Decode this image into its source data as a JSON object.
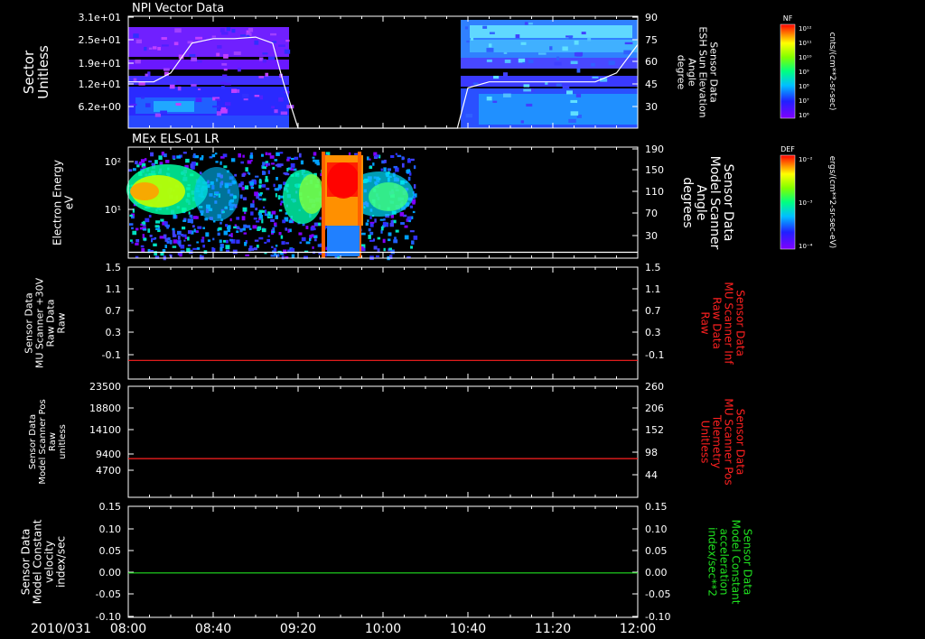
{
  "chart_data": [
    {
      "type": "heatmap",
      "title": "NPI Vector Data",
      "ylabel_left": [
        "Sector",
        "Unitless"
      ],
      "ylabel_right": [
        "Sensor Data",
        "ESH Sun Elevation",
        "Angle",
        "degree"
      ],
      "yticks_left": [
        "3.1e+01",
        "2.5e+01",
        "1.9e+01",
        "1.2e+01",
        "6.2e+00"
      ],
      "yticks_right": [
        "90",
        "75",
        "60",
        "45",
        "30"
      ],
      "ylim_right": [
        15,
        90
      ],
      "color": "#ffffff",
      "line": {
        "x": [
          "08:00",
          "08:12",
          "08:20",
          "08:30",
          "08:40",
          "08:50",
          "09:00",
          "09:08",
          "09:13",
          "09:20",
          "10:20",
          "10:35",
          "10:40",
          "10:50",
          "11:20",
          "11:40",
          "11:50",
          "12:00"
        ],
        "y": [
          46,
          46,
          52,
          72,
          75,
          75,
          76,
          72,
          46,
          15,
          15,
          15,
          42,
          46,
          46,
          46,
          52,
          71
        ]
      },
      "colorbar": {
        "label": "NF",
        "unit": "cnts/(cm**2-sr-sec)",
        "ticks": [
          "10¹²",
          "10¹¹",
          "10¹⁰",
          "10⁹",
          "10⁸",
          "10⁷",
          "10⁶"
        ]
      }
    },
    {
      "type": "heatmap",
      "title": "MEx ELS-01 LR",
      "ylabel_left": [
        "Electron Energy",
        "eV"
      ],
      "ylabel_right": [
        "Sensor Data",
        "Model Scanner",
        "Angle",
        "degrees"
      ],
      "yticks_left": [
        "10²",
        "10¹"
      ],
      "yticks_right": [
        "190",
        "150",
        "110",
        "70",
        "30"
      ],
      "ylim_right": [
        0,
        190
      ],
      "color": "#ffffff",
      "line": {
        "x": [
          "08:00",
          "12:00"
        ],
        "y": [
          10,
          10
        ]
      },
      "colorbar": {
        "label": "DEF",
        "unit": "ergs/(cm**2-sr-sec-eV)",
        "ticks": [
          "10⁻²",
          "10⁻³",
          "10⁻⁴"
        ]
      }
    },
    {
      "type": "line",
      "ylabel_left": [
        "Sensor Data",
        "MU Scanner +30V",
        "Raw Data",
        "Raw"
      ],
      "ylabel_right": [
        "Sensor Data",
        "MU Scanner Inf",
        "Raw Data",
        "Raw"
      ],
      "yticks_left": [
        "1.5",
        "1.1",
        "0.7",
        "0.3",
        "-0.1"
      ],
      "yticks_right": [
        "1.5",
        "1.1",
        "0.7",
        "0.3",
        "-0.1"
      ],
      "ylim": [
        -0.3,
        1.5
      ],
      "color": "#ff2020",
      "line": {
        "x": [
          "08:00",
          "12:00"
        ],
        "y": [
          0.0,
          0.0
        ]
      }
    },
    {
      "type": "line",
      "ylabel_left": [
        "Sensor Data",
        "Model Scanner Pos",
        "Raw",
        "unitless"
      ],
      "ylabel_right": [
        "Sensor Data",
        "MU Scanner Pos",
        "Telemetry",
        "Unitless"
      ],
      "yticks_left": [
        "23500",
        "18800",
        "14100",
        "9400",
        "4700"
      ],
      "yticks_right": [
        "260",
        "206",
        "152",
        "98",
        "44"
      ],
      "ylim": [
        0,
        23500
      ],
      "color": "#ff2020",
      "line": {
        "x": [
          "08:00",
          "12:00"
        ],
        "y": [
          8200,
          8200
        ]
      }
    },
    {
      "type": "line",
      "ylabel_left": [
        "Sensor Data",
        "Model Constant",
        "velocity",
        "index/sec"
      ],
      "ylabel_right": [
        "Sensor Data",
        "Model Constant",
        "acceleration",
        "index/sec**2"
      ],
      "yticks_left": [
        "0.15",
        "0.10",
        "0.05",
        "0.00",
        "-0.05",
        "-0.10"
      ],
      "yticks_right": [
        "0.15",
        "0.10",
        "0.05",
        "0.00",
        "-0.05",
        "-0.10"
      ],
      "ylim": [
        -0.1,
        0.15
      ],
      "color": "#20e020",
      "line": {
        "x": [
          "08:00",
          "12:00"
        ],
        "y": [
          0.0,
          0.0
        ]
      }
    }
  ],
  "xaxis": {
    "date": "2010/031",
    "ticks": [
      "08:00",
      "08:40",
      "09:20",
      "10:00",
      "10:40",
      "11:20",
      "12:00"
    ]
  }
}
